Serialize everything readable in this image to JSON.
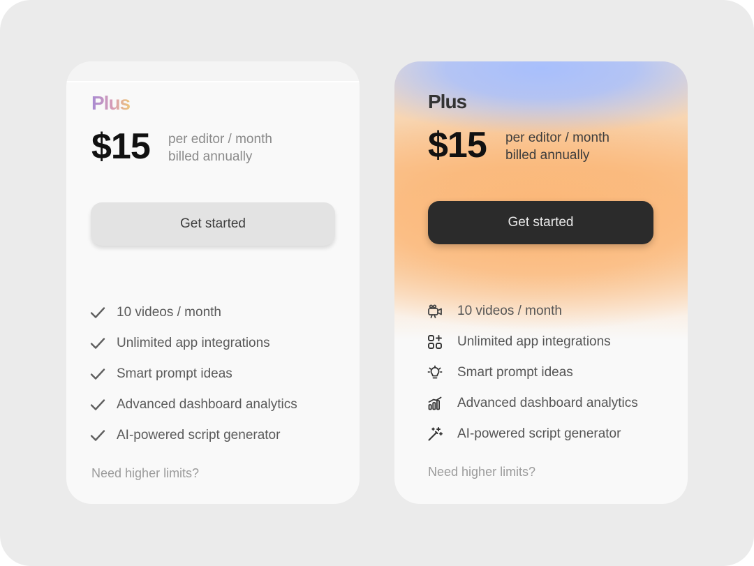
{
  "colors": {
    "frame_bg": "#ebebeb",
    "card_bg": "#f9f9f9",
    "gradient_blue": "#a8bffc",
    "gradient_orange": "#fbb676",
    "cta_dark": "#2b2b2b",
    "cta_light": "#e3e3e3"
  },
  "cards": [
    {
      "plan_name": "Plus",
      "price": "$15",
      "price_line1": "per editor / month",
      "price_line2": "billed annually",
      "cta_label": "Get started",
      "features": [
        {
          "icon": "check-icon",
          "label": "10 videos / month"
        },
        {
          "icon": "check-icon",
          "label": "Unlimited app integrations"
        },
        {
          "icon": "check-icon",
          "label": "Smart prompt ideas"
        },
        {
          "icon": "check-icon",
          "label": "Advanced dashboard analytics"
        },
        {
          "icon": "check-icon",
          "label": "AI-powered script generator"
        }
      ],
      "limits_link": "Need higher limits?"
    },
    {
      "plan_name": "Plus",
      "price": "$15",
      "price_line1": "per editor / month",
      "price_line2": "billed annually",
      "cta_label": "Get started",
      "features": [
        {
          "icon": "video-camera-icon",
          "label": "10 videos / month"
        },
        {
          "icon": "apps-grid-icon",
          "label": "Unlimited app integrations"
        },
        {
          "icon": "lightbulb-icon",
          "label": "Smart prompt ideas"
        },
        {
          "icon": "bar-chart-icon",
          "label": "Advanced dashboard analytics"
        },
        {
          "icon": "magic-wand-icon",
          "label": "AI-powered script generator"
        }
      ],
      "limits_link": "Need higher limits?"
    }
  ]
}
